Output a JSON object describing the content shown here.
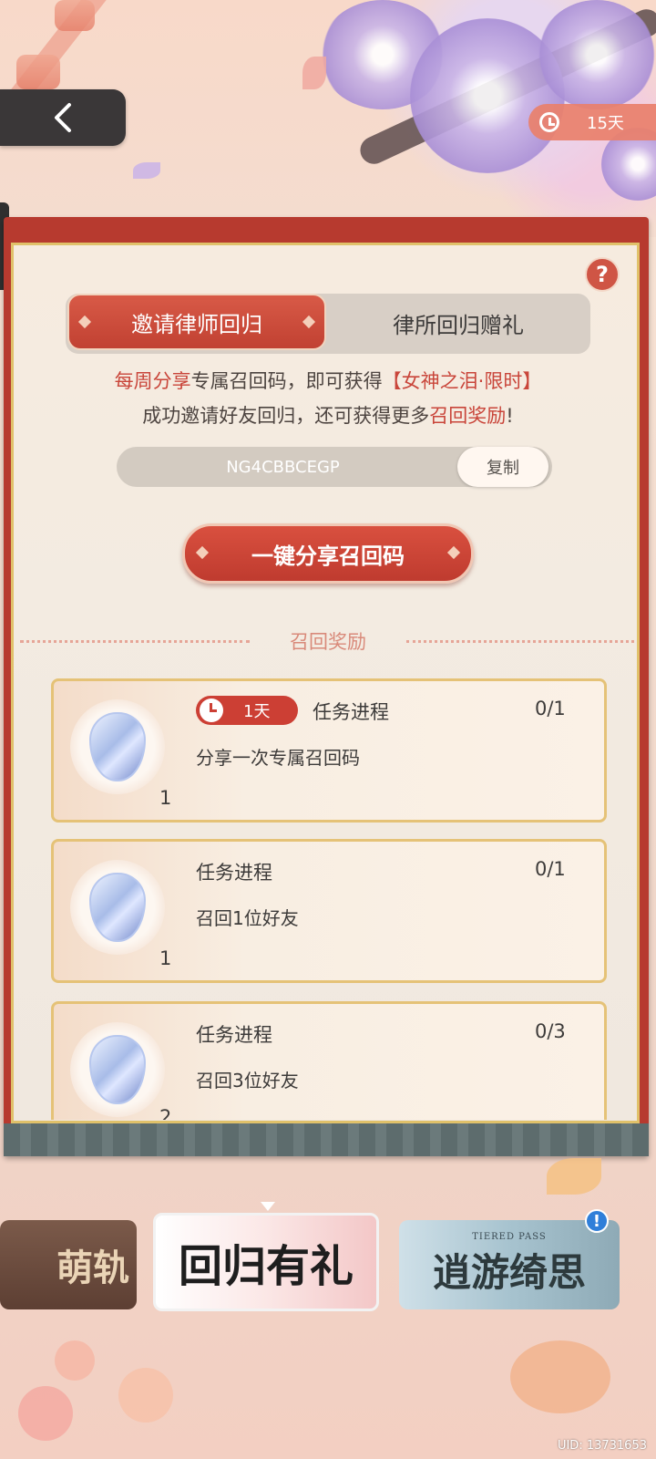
{
  "header": {
    "back_icon": "chevron-left-icon",
    "days_left": "15天"
  },
  "tabs": [
    {
      "label": "邀请律师回归",
      "active": true
    },
    {
      "label": "律所回归赠礼",
      "active": false
    }
  ],
  "intro": {
    "line1_a": "每周分享",
    "line1_b": "专属召回码，即可获得",
    "line1_c": "【女神之泪·限时】",
    "line2_a": "成功邀请好友回归，还可获得更多",
    "line2_b": "召回奖励",
    "line2_c": "!"
  },
  "code": {
    "value": "NG4CBBCEGP",
    "copy_label": "复制"
  },
  "share_button": "一键分享召回码",
  "rewards": {
    "title": "召回奖励",
    "tasks": [
      {
        "timer": "1天",
        "title": "任务进程",
        "progress": "0/1",
        "desc": "分享一次专属召回码",
        "qty": "1"
      },
      {
        "title": "任务进程",
        "progress": "0/1",
        "desc": "召回1位好友",
        "qty": "1"
      },
      {
        "title": "任务进程",
        "progress": "0/3",
        "desc": "召回3位好友",
        "qty": "2"
      }
    ]
  },
  "banners": {
    "b1": "萌轨",
    "b2": "回归有礼",
    "b3": "逍游绮思",
    "b3_sub": "TIERED PASS"
  },
  "notif_mark": "!",
  "help_mark": "?",
  "uid": "UID: 13731653",
  "colors": {
    "accent": "#c9453a",
    "panel_border": "#b73a2f",
    "gold": "#e0c16a"
  }
}
